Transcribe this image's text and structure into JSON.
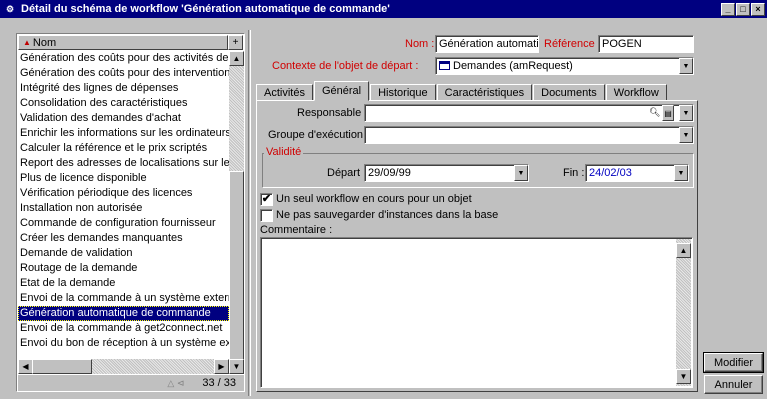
{
  "window": {
    "title": "Détail du schéma de workflow 'Génération automatique de commande'"
  },
  "list": {
    "column_header": "Nom",
    "items": [
      "Génération des coûts pour des activités de sui",
      "Génération des coûts pour des interventions",
      "Intégrité des lignes de dépenses",
      "Consolidation des caractéristiques",
      "Validation des demandes d'achat",
      "Enrichir les informations sur les ordinateurs",
      "Calculer la référence et le prix scriptés",
      "Report des adresses de localisations sur les so",
      "Plus de licence disponible",
      "Vérification périodique des licences",
      "Installation non autorisée",
      "Commande de configuration fournisseur",
      "Créer les demandes manquantes",
      "Demande de validation",
      "Routage de la demande",
      "Etat de la demande",
      "Envoi de la commande à un système externe",
      "Génération automatique de commande",
      "Envoi  de la commande à get2connect.net",
      "Envoi du bon de réception à un système exter"
    ],
    "selected_index": 17,
    "counter": "33 / 33"
  },
  "form": {
    "nom_label": "Nom :",
    "nom_value": "Génération automati",
    "reference_label": "Référence :",
    "reference_value": "POGEN",
    "contexte_label": "Contexte de l'objet de départ :",
    "contexte_value": "Demandes (amRequest)"
  },
  "tabs": [
    "Activités",
    "Général",
    "Historique",
    "Caractéristiques",
    "Documents",
    "Workflow"
  ],
  "active_tab": 1,
  "general": {
    "responsable_label": "Responsable :",
    "responsable_value": "",
    "groupe_label": "Groupe d'exécution :",
    "groupe_value": "",
    "validite_title": "Validité",
    "depart_label": "Départ :",
    "depart_value": "29/09/99",
    "fin_label": "Fin :",
    "fin_value": "24/02/03",
    "checkbox1_label": "Un seul workflow en cours pour un objet",
    "checkbox1_checked": true,
    "checkbox2_label": "Ne pas sauvegarder d'instances dans la base",
    "checkbox2_checked": false,
    "commentaire_label": "Commentaire :",
    "commentaire_value": ""
  },
  "buttons": {
    "modifier": "Modifier",
    "annuler": "Annuler"
  },
  "colors": {
    "titlebar": "#000080",
    "selection": "#000080",
    "required_label": "#d00000",
    "face": "#c0c0c0"
  }
}
